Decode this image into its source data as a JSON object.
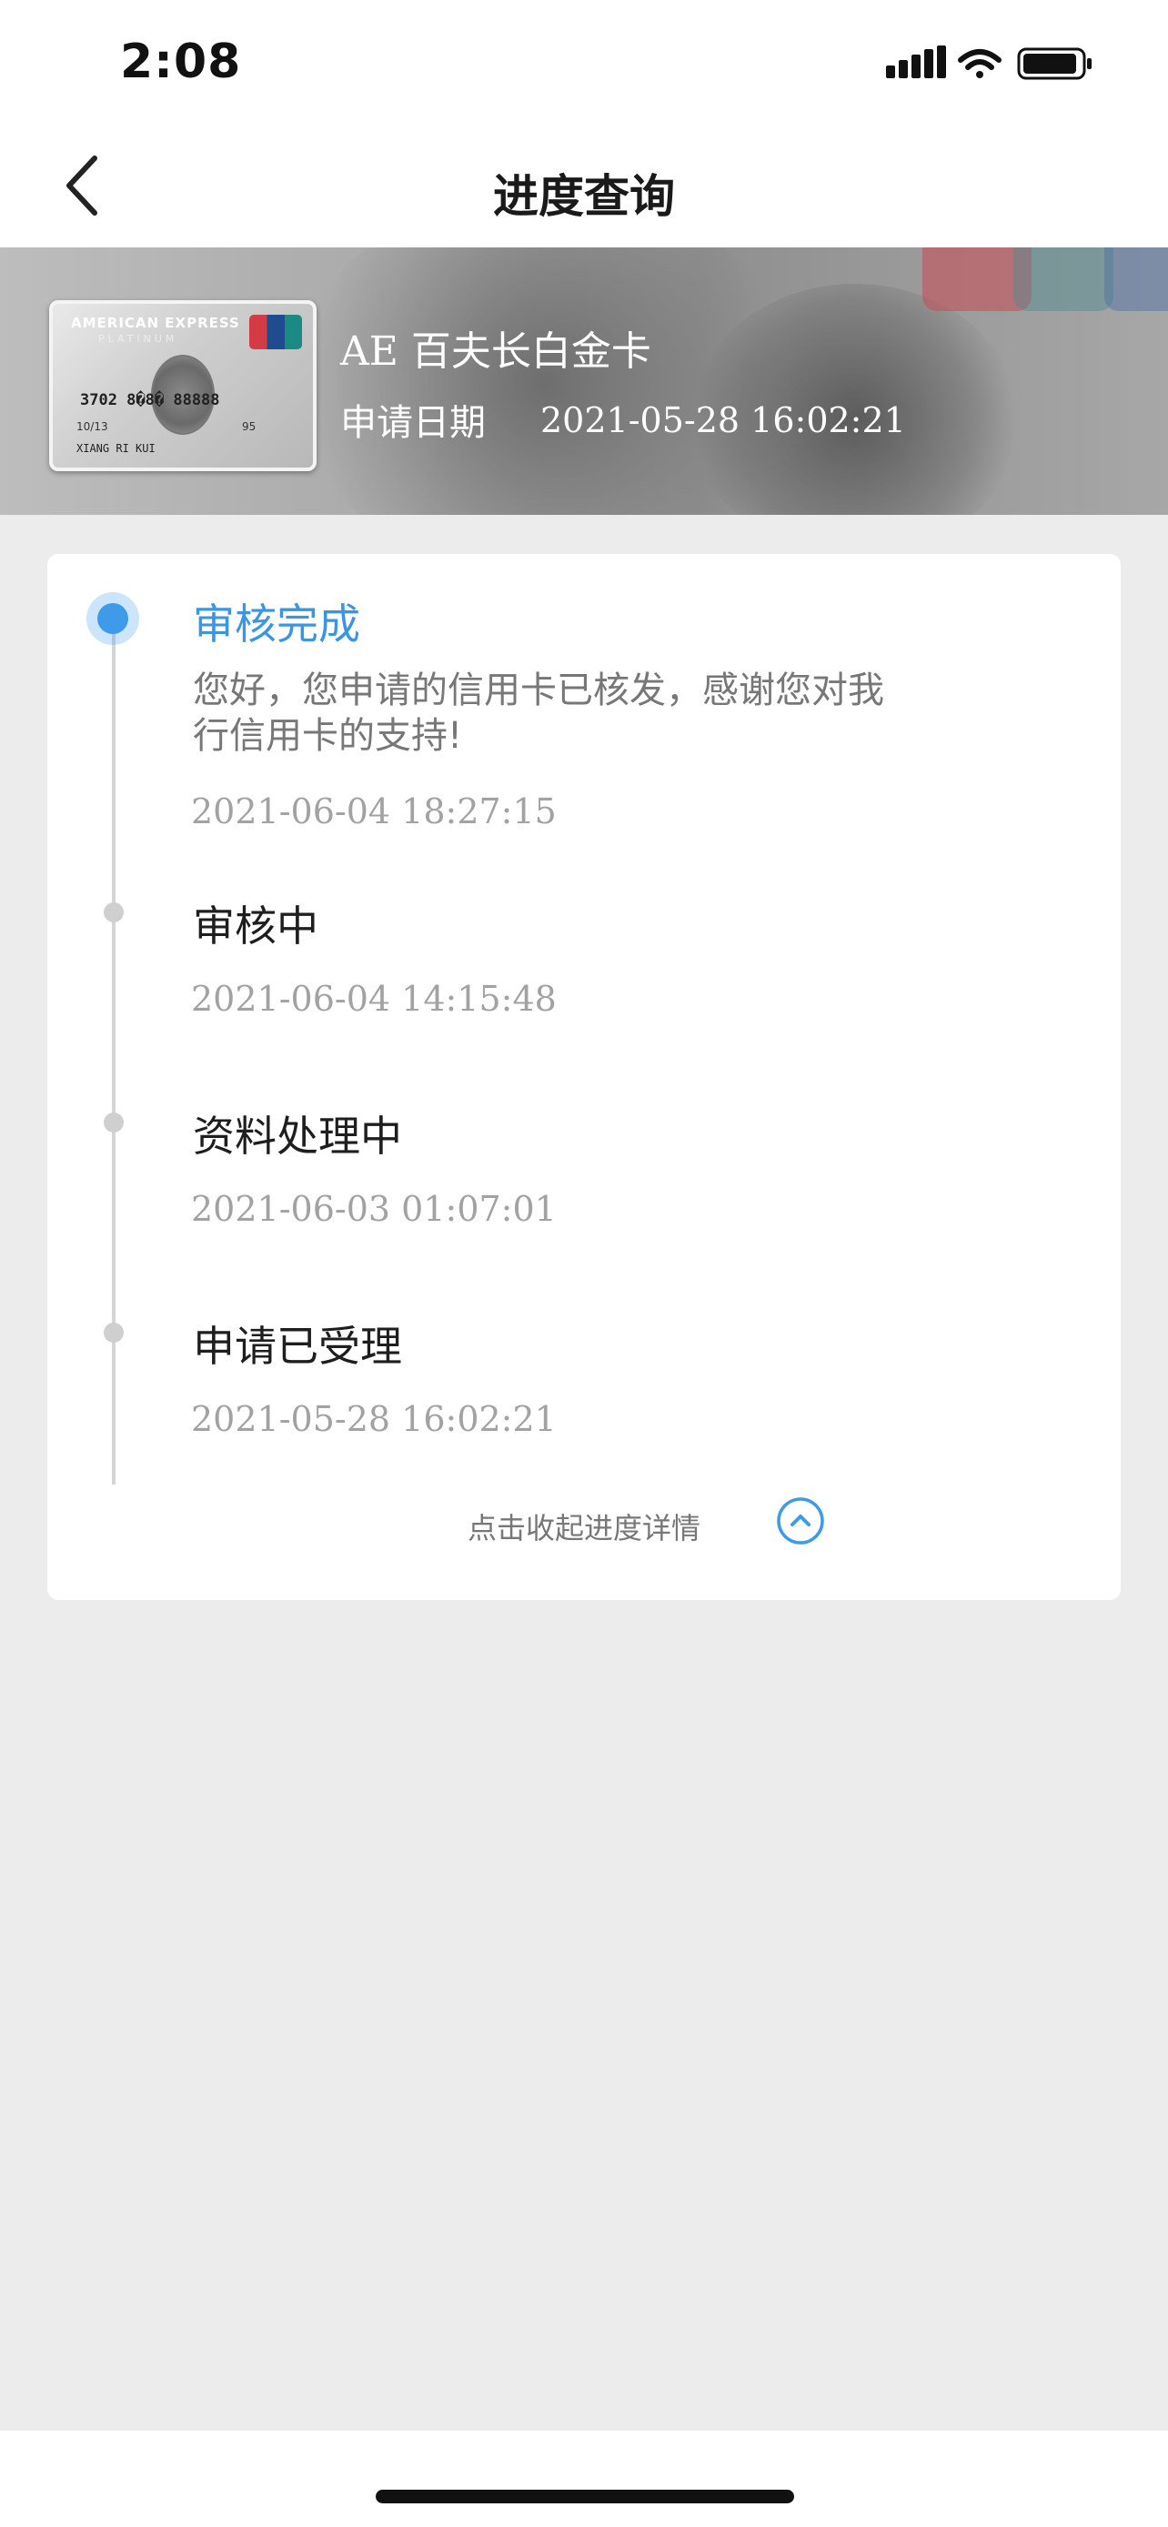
{
  "status_bar": {
    "time": "2:08"
  },
  "nav": {
    "title": "进度查询"
  },
  "card": {
    "name": "AE 百夫长白金卡",
    "apply_date_label": "申请日期",
    "apply_date": "2021-05-28 16:02:21",
    "image": {
      "brand": "AMERICAN EXPRESS",
      "tier": "PLATINUM",
      "number": "3702 8�8� 88888",
      "expiry": "10/13",
      "code": "95",
      "holder": "XIANG RI KUI"
    }
  },
  "steps": [
    {
      "title": "审核完成",
      "description": "您好，您申请的信用卡已核发，感谢您对我行信用卡的支持!",
      "time": "2021-06-04 18:27:15",
      "active": true
    },
    {
      "title": "审核中",
      "time": "2021-06-04 14:15:48"
    },
    {
      "title": "资料处理中",
      "time": "2021-06-03 01:07:01"
    },
    {
      "title": "申请已受理",
      "time": "2021-05-28 16:02:21"
    }
  ],
  "collapse": {
    "label": "点击收起进度详情"
  },
  "colors": {
    "accent": "#3d9bea",
    "background": "#ececec",
    "inactive_dot": "#cfcfcf"
  }
}
